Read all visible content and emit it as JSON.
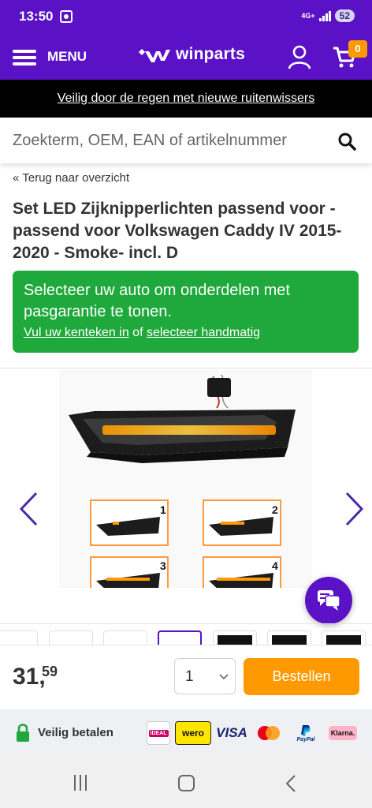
{
  "status_bar": {
    "time": "13:50",
    "network": "4G+",
    "battery": "52",
    "icons": [
      "screen-record-icon",
      "signal-icon"
    ]
  },
  "header": {
    "menu_label": "MENU",
    "logo_text": "winparts",
    "cart_count": "0",
    "colors": {
      "brand": "#5b12c7",
      "accent": "#ff9900"
    },
    "icons": [
      "menu-icon",
      "user-icon",
      "cart-icon"
    ]
  },
  "promo": {
    "text": "Veilig door de regen met nieuwe ruitenwissers"
  },
  "search": {
    "placeholder": "Zoekterm, OEM, EAN of artikelnummer",
    "icon": "search-icon"
  },
  "breadcrumb": {
    "back_label": "« Terug naar overzicht"
  },
  "product": {
    "title": "Set LED Zijknipperlichten passend voor - passend voor Volkswagen Caddy IV 2015-2020 - Smoke- incl. D",
    "image_labels": [
      "1",
      "2",
      "3",
      "4"
    ],
    "gallery_icons": [
      "chevron-left-icon",
      "chevron-right-icon"
    ]
  },
  "vehicle_box": {
    "message": "Selecteer uw auto om onderdelen met pasgarantie te tonen.",
    "link_plate": "Vul uw kenteken in",
    "link_sep": "of",
    "link_manual": "selecteer handmatig",
    "color": "#1fa83b"
  },
  "buy": {
    "price_int": "31,",
    "price_dec": "59",
    "quantity": "1",
    "order_label": "Bestellen"
  },
  "payment": {
    "label": "Veilig betalen",
    "ideal": "iDEAL",
    "wero": "wero",
    "visa": "VISA",
    "paypal": "PayPal",
    "klarna": "Klarna."
  },
  "system_nav": {
    "icons": [
      "recents-icon",
      "home-icon",
      "back-icon"
    ]
  }
}
